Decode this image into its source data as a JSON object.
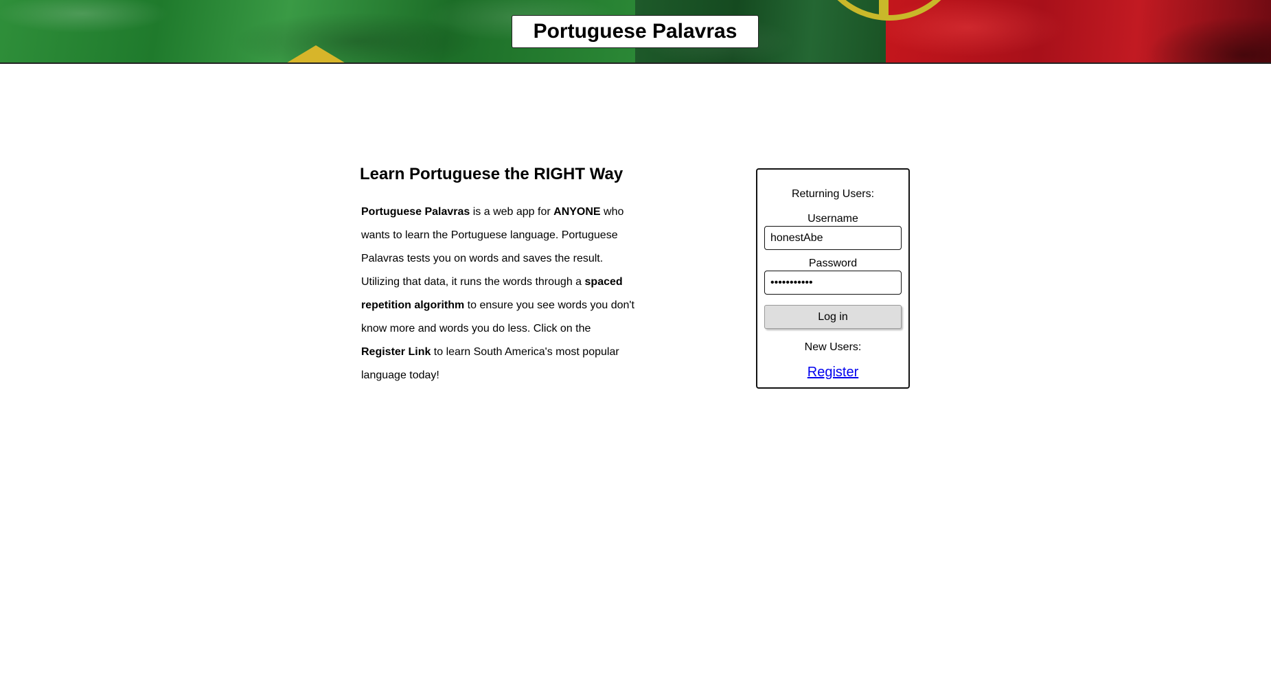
{
  "header": {
    "title": "Portuguese Palavras"
  },
  "intro": {
    "heading": "Learn Portuguese the RIGHT Way",
    "paragraph": {
      "app_name": "Portuguese Palavras",
      "text1": " is a web app for ",
      "anyone": "ANYONE",
      "text2": " who wants to learn the Portuguese language. Portuguese Palavras tests you on words and saves the result. Utilizing that data, it runs the words through a ",
      "algorithm": "spaced repetition algorithm",
      "text3": " to ensure you see words you don't know more and words you do less. Click on the ",
      "register_link": "Register Link",
      "text4": " to learn South America's most popular language today!"
    }
  },
  "login": {
    "returning_label": "Returning Users:",
    "username_label": "Username",
    "username_value": "honestAbe",
    "password_label": "Password",
    "password_value": "•••••••••••",
    "login_button": "Log in",
    "new_users_label": "New Users:",
    "register_link": "Register"
  },
  "colors": {
    "brazil_green": "#2f8f3a",
    "brazil_yellow": "#d7b52a",
    "portugal_green": "#1e5a2a",
    "portugal_red": "#c4161c",
    "link": "#0000ee",
    "button_bg": "#dedede"
  }
}
